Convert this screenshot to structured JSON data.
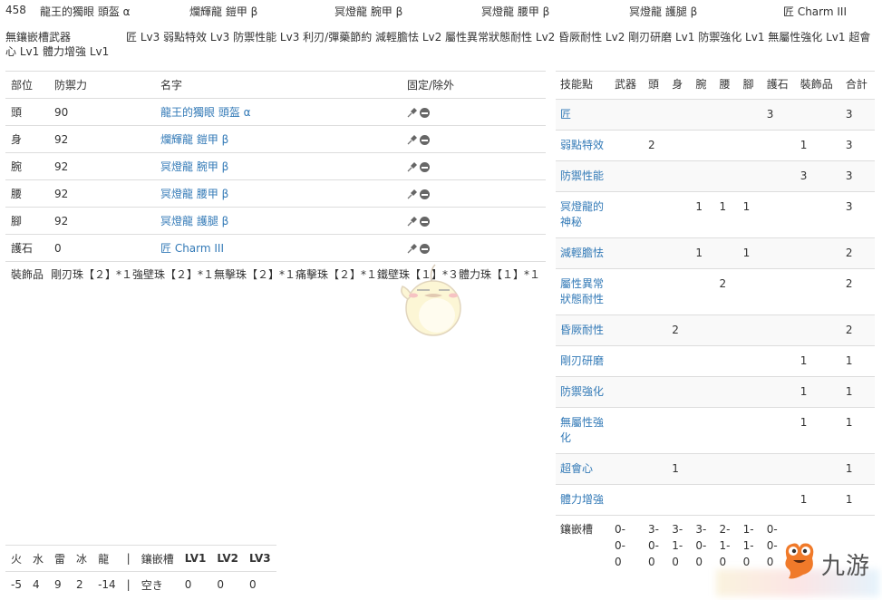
{
  "summary": {
    "id": "458",
    "head": "龍王的獨眼 頭盔 α",
    "body": "爛輝龍 鎧甲 β",
    "arms": "冥燈龍 腕甲 β",
    "waist": "冥燈龍 腰甲 β",
    "legs": "冥燈龍 護腿 β",
    "charm": "匠 Charm III"
  },
  "skills_line": {
    "weapon": "無鑲嵌槽武器",
    "text": "匠 Lv3 弱點特效 Lv3 防禦性能 Lv3 利刃/彈藥節約 減輕膽怯 Lv2 屬性異常狀態耐性 Lv2 昏厥耐性 Lv2 剛刃研磨 Lv1 防禦強化 Lv1 無屬性強化 Lv1 超會心 Lv1 體力增強 Lv1"
  },
  "equipment_table": {
    "headers": [
      "部位",
      "防禦力",
      "名字",
      "固定/除外"
    ],
    "rows": [
      {
        "slot": "頭",
        "defense": "90",
        "name": "龍王的獨眼 頭盔 α"
      },
      {
        "slot": "身",
        "defense": "92",
        "name": "爛輝龍 鎧甲 β"
      },
      {
        "slot": "腕",
        "defense": "92",
        "name": "冥燈龍 腕甲 β"
      },
      {
        "slot": "腰",
        "defense": "92",
        "name": "冥燈龍 腰甲 β"
      },
      {
        "slot": "腳",
        "defense": "92",
        "name": "冥燈龍 護腿 β"
      },
      {
        "slot": "護石",
        "defense": "0",
        "name": "匠 Charm III"
      }
    ],
    "icons": {
      "fix": "pin-icon",
      "exclude": "minus-circle-icon"
    }
  },
  "decorations": {
    "label": "裝飾品",
    "text": "剛刃珠【２】*１強壁珠【２】*１無擊珠【２】*１痛擊珠【２】*１鐵壁珠【１】*３體力珠【１】*１"
  },
  "skill_table": {
    "headers": [
      "技能點",
      "武器",
      "頭",
      "身",
      "腕",
      "腰",
      "腳",
      "護石",
      "裝飾品",
      "合計"
    ],
    "rows": [
      {
        "name": "匠",
        "cells": [
          "",
          "",
          "",
          "",
          "",
          "",
          "3",
          "",
          "3"
        ]
      },
      {
        "name": "弱點特效",
        "cells": [
          "",
          "2",
          "",
          "",
          "",
          "",
          "",
          "1",
          "3"
        ]
      },
      {
        "name": "防禦性能",
        "cells": [
          "",
          "",
          "",
          "",
          "",
          "",
          "",
          "3",
          "3"
        ]
      },
      {
        "name": "冥燈龍的神秘",
        "cells": [
          "",
          "",
          "",
          "1",
          "1",
          "1",
          "",
          "",
          "3"
        ]
      },
      {
        "name": "減輕膽怯",
        "cells": [
          "",
          "",
          "",
          "1",
          "",
          "1",
          "",
          "",
          "2"
        ]
      },
      {
        "name": "屬性異常狀態耐性",
        "cells": [
          "",
          "",
          "",
          "",
          "2",
          "",
          "",
          "",
          "2"
        ]
      },
      {
        "name": "昏厥耐性",
        "cells": [
          "",
          "",
          "2",
          "",
          "",
          "",
          "",
          "",
          "2"
        ]
      },
      {
        "name": "剛刃研磨",
        "cells": [
          "",
          "",
          "",
          "",
          "",
          "",
          "",
          "1",
          "1"
        ]
      },
      {
        "name": "防禦強化",
        "cells": [
          "",
          "",
          "",
          "",
          "",
          "",
          "",
          "1",
          "1"
        ]
      },
      {
        "name": "無屬性強化",
        "cells": [
          "",
          "",
          "",
          "",
          "",
          "",
          "",
          "1",
          "1"
        ]
      },
      {
        "name": "超會心",
        "cells": [
          "",
          "",
          "1",
          "",
          "",
          "",
          "",
          "",
          "1"
        ]
      },
      {
        "name": "體力增強",
        "cells": [
          "",
          "",
          "",
          "",
          "",
          "",
          "",
          "1",
          "1"
        ]
      }
    ],
    "slots_row": {
      "name": "鑲嵌槽",
      "cells": [
        "0-0-0",
        "3-0-0",
        "3-1-0",
        "3-0-0",
        "2-1-0",
        "1-1-0",
        "0-0-0",
        "",
        ""
      ]
    }
  },
  "resistance_table": {
    "headers": [
      "火",
      "水",
      "雷",
      "冰",
      "龍",
      "|",
      "鑲嵌槽",
      "LV1",
      "LV2",
      "LV3"
    ],
    "values": [
      "-5",
      "4",
      "9",
      "2",
      "-14",
      "|",
      "空き",
      "0",
      "0",
      "0"
    ]
  },
  "watermark": {
    "brand": "九游",
    "mascot": "mascot-icon"
  },
  "colors": {
    "link": "#337ab7",
    "border": "#dddddd",
    "stripe": "#f9f9f9",
    "text": "#333333"
  }
}
